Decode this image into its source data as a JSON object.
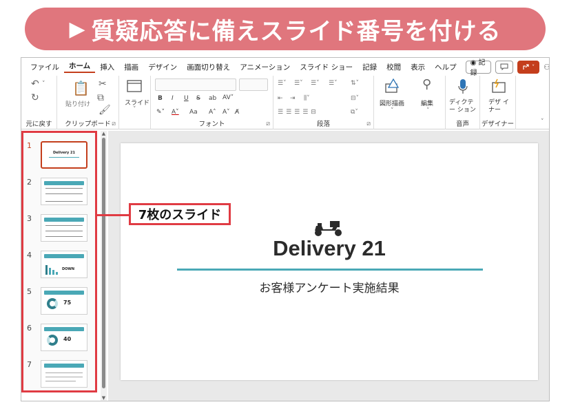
{
  "banner": {
    "arrow": "▶",
    "title": "質疑応答に備えスライド番号を付ける"
  },
  "menubar": {
    "items": [
      "ファイル",
      "ホーム",
      "挿入",
      "描画",
      "デザイン",
      "画面切り替え",
      "アニメーション",
      "スライド ショー",
      "記録",
      "校閲",
      "表示",
      "ヘルプ"
    ],
    "active": "ホーム",
    "record_button": "◉ 記録",
    "comment_icon": "comment-icon",
    "share_icon": "share-icon"
  },
  "ribbon": {
    "undo_group": "元に戻す",
    "clipboard": {
      "label": "クリップボード",
      "paste": "貼り付け"
    },
    "slides": {
      "label": "スライド"
    },
    "font": {
      "label": "フォント",
      "bold": "B",
      "italic": "I",
      "underline": "U",
      "strike": "S",
      "shadow": "ab",
      "aa": "Aa",
      "size_up": "A˄",
      "size_down": "A˅"
    },
    "paragraph": {
      "label": "段落"
    },
    "drawing": {
      "label": "図形描画"
    },
    "editing": {
      "label": "編集"
    },
    "voice": {
      "label": "音声",
      "dictate": "ディクテー ション"
    },
    "designer": {
      "label": "デザイナー",
      "button": "デザ イナー"
    }
  },
  "thumbnails": [
    {
      "num": "1",
      "title": "Delivery 21"
    },
    {
      "num": "2",
      "title": ""
    },
    {
      "num": "3",
      "title": ""
    },
    {
      "num": "4",
      "title": "DOWN"
    },
    {
      "num": "5",
      "title": "75"
    },
    {
      "num": "6",
      "title": "40"
    },
    {
      "num": "7",
      "title": ""
    }
  ],
  "slide": {
    "title": "Delivery 21",
    "subtitle": "お客様アンケート実施結果",
    "icon": "scooter-icon"
  },
  "callout": {
    "text": "7枚のスライド"
  },
  "colors": {
    "banner": "#e0767d",
    "accent": "#c43e1c",
    "teal": "#4aa8b6",
    "highlight": "#e03b43"
  }
}
